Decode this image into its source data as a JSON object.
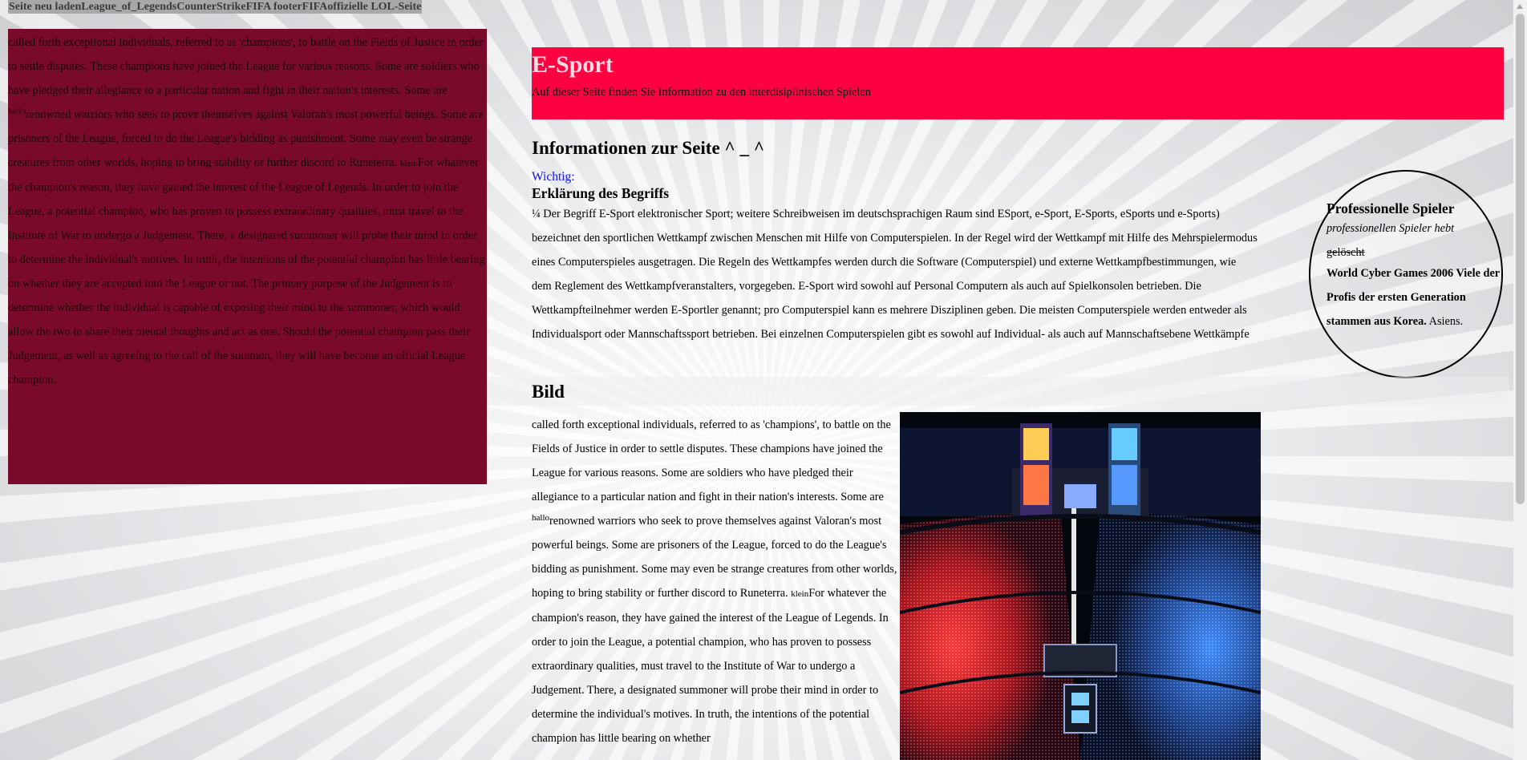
{
  "nav": {
    "links": [
      "Seite neu laden",
      "League_of_Legends",
      "CounterStrike",
      "FIFA footer",
      "FIFA",
      "offizielle LOL-Seite"
    ]
  },
  "left_panel": {
    "part1": "called forth exceptional individuals, referred to as 'champions', to battle on the Fields of Justice in order to settle disputes. These champions have joined the League for various reasons. Some are soldiers who have pledged their allegiance to a particular nation and fight in their nation's interests. Some are ",
    "sup": "hallo",
    "part2": "renowned warriors who seek to prove themselves against Valoran's most powerful beings. Some are prisoners of the League, forced to do the League's bidding as punishment. Some may even be strange creatures from other worlds, hoping to bring stability or further discord to Runeterra. ",
    "small": "klein",
    "part3": "For whatever the champion's reason, they have gained the interest of the League of Legends. In order to join the League, a potential champion, who has proven to possess extraordinary qualities, must travel to the Institute of War to undergo a Judgement. There, a designated summoner will probe their mind in order to determine the individual's motives. In truth, the intentions of the potential champion has little bearing on whether they are accepted into the League or not. The primary purpose of the Judgement is to determine whether the individual is capable of exposing their mind to the summoner, which would allow the two to share their mental thoughts and act as one. Should the potential champion pass their Judgement, as well as agreeing to the call of the summon, they will have become an official League champion."
  },
  "header": {
    "title": "E-Sport",
    "subtitle": "Auf dieser Seite finden Sie Information zu den interdisiplinischen Spielen"
  },
  "info": {
    "title": "Informationen zur Seite ^ _ ^",
    "wichtig": "Wichtig:",
    "erk_title": "Erklärung des Begriffs",
    "erk_text": "¼ Der Begriff E-Sport elektronischer Sport; weitere Schreibweisen im deutschsprachigen Raum sind ESport, e-Sport, E-Sports, eSports und e-Sports) bezeichnet den sportlichen Wettkampf zwischen Menschen mit Hilfe von Computerspielen. In der Regel wird der Wettkampf mit Hilfe des Mehrspielermodus eines Computerspieles ausgetragen. Die Regeln des Wettkampfes werden durch die Software (Computerspiel) und externe Wettkampfbestimmungen, wie dem Reglement des Wettkampfveranstalters, vorgegeben. E-Sport wird sowohl auf Personal Computern als auch auf Spielkonsolen betrieben. Die Wettkampfteilnehmer werden E-Sportler genannt; pro Computerspiel kann es mehrere Disziplinen geben. Die meisten Computerspiele werden entweder als Individualsport oder Mannschaftssport betrieben. Bei einzelnen Computerspielen gibt es sowohl auf Individual- als auch auf Mannschaftsebene Wettkämpfe"
  },
  "circle": {
    "title": "Professionelle Spieler",
    "italic": "professionellen Spieler hebt",
    "struck": "gelöscht",
    "bold": "World Cyber Games 2006 Viele der Profis der ersten Generation stammen aus Korea.",
    "tail": " Asiens."
  },
  "bild": {
    "title": "Bild",
    "part1": "called forth exceptional individuals, referred to as 'champions', to battle on the Fields of Justice in order to settle disputes. These champions have joined the League for various reasons. Some are soldiers who have pledged their allegiance to a particular nation and fight in their nation's interests. Some are ",
    "sup": "hallo",
    "part2": "renowned warriors who seek to prove themselves against Valoran's most powerful beings. Some are prisoners of the League, forced to do the League's bidding as punishment. Some may even be strange creatures from other worlds, hoping to bring stability or further discord to Runeterra. ",
    "small": "klein",
    "part3": "For whatever the champion's reason, they have gained the interest of the League of Legends. In order to join the League, a potential champion, who has proven to possess extraordinary qualities, must travel to the Institute of War to undergo a Judgement. There, a designated summoner will probe their mind in order to determine the individual's motives. In truth, the intentions of the potential champion has little bearing on whether"
  },
  "colors": {
    "left_panel_bg": "#7a0a2a",
    "header_bg": "#ff0040",
    "wichtig": "#1010ff"
  }
}
